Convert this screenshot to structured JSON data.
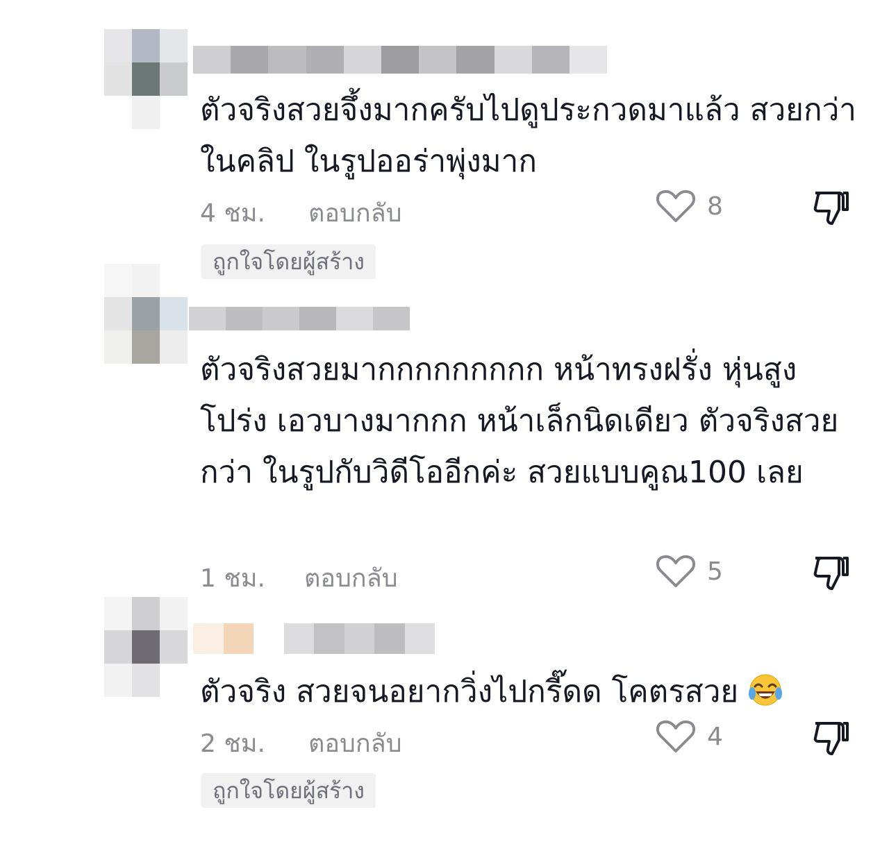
{
  "comments": [
    {
      "text": "ตัวจริงสวยจึ้งมากครับไปดูประกวดมาแล้ว สวยกว่า ในคลิป ในรูปออร่าพุ่งมาก",
      "timestamp": "4 ชม.",
      "reply_label": "ตอบกลับ",
      "like_count": "8",
      "creator_badge": "ถูกใจโดยผู้สร้าง"
    },
    {
      "text": "ตัวจริงสวยมากกกกกกกกก หน้าทรงฝรั่ง หุ่นสูงโปร่ง เอวบางมากกก หน้าเล็กนิดเดียว ตัวจริงสวยกว่า ในรูปกับวิดีโออีกค่ะ สวยแบบคูณ100 เลย",
      "timestamp": "1 ชม.",
      "reply_label": "ตอบกลับ",
      "like_count": "5"
    },
    {
      "text": "ตัวจริง สวยจนอยากวิ่งไปกรี๊ดด โคตรสวย",
      "emoji": "laughing-tears-icon",
      "timestamp": "2 ชม.",
      "reply_label": "ตอบกลับ",
      "like_count": "4",
      "creator_badge": "ถูกใจโดยผู้สร้าง"
    }
  ],
  "icons": {
    "like": "heart-outline-icon",
    "dislike": "thumbs-down-icon"
  },
  "colors": {
    "text_primary": "#161823",
    "text_secondary": "#8a8b91",
    "badge_background": "#f1f1f2",
    "icon_stroke": "#8a8b91"
  }
}
